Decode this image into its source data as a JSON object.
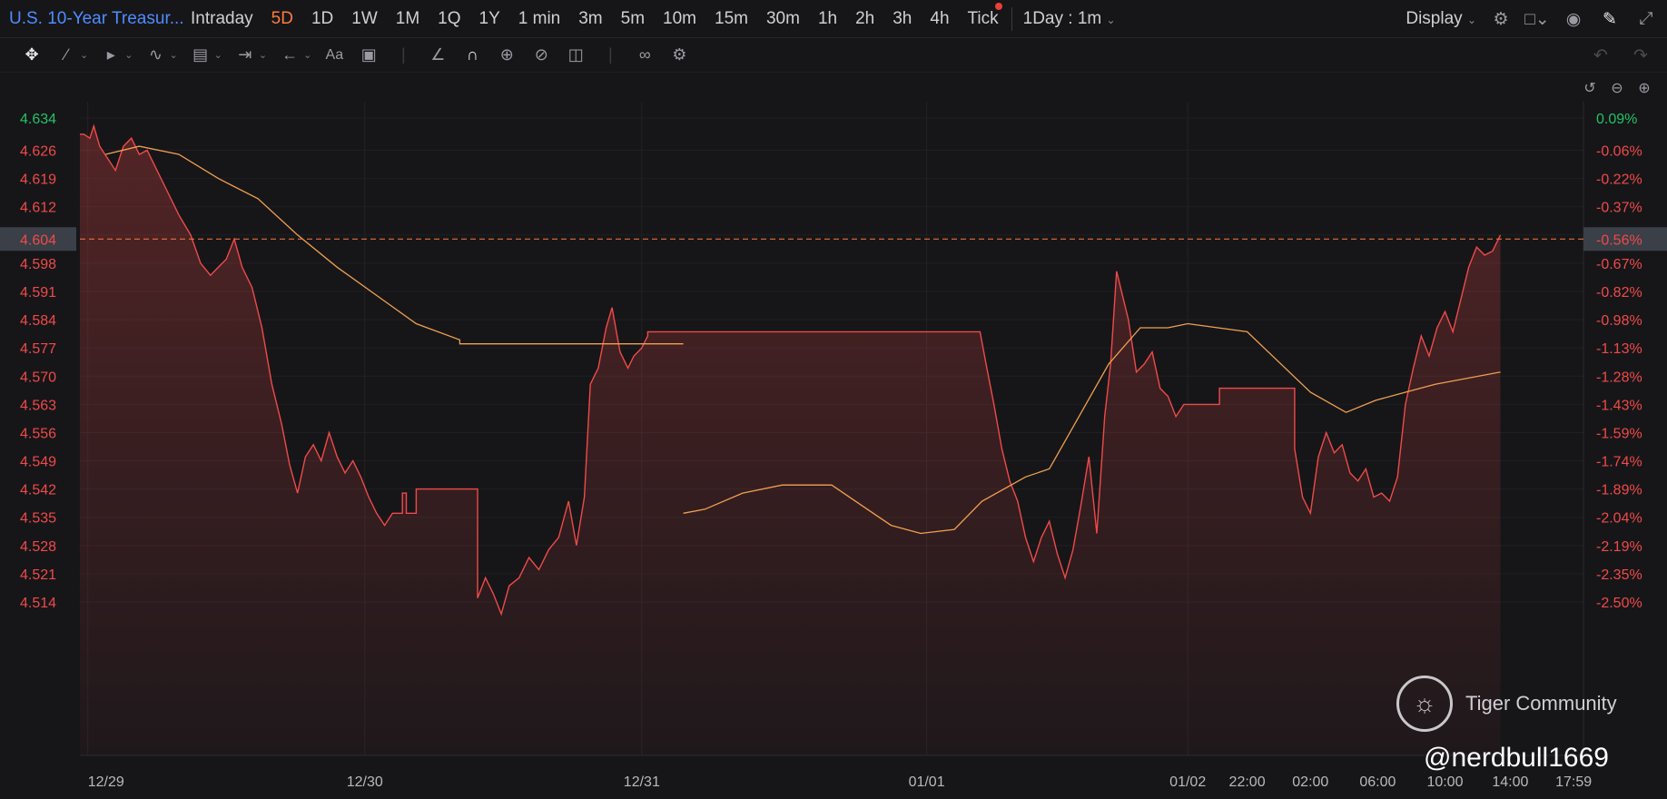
{
  "header": {
    "symbol": "U.S. 10-Year Treasur...",
    "periods": [
      "Intraday",
      "5D",
      "1D",
      "1W",
      "1M",
      "1Q",
      "1Y",
      "1 min",
      "3m",
      "5m",
      "10m",
      "15m",
      "30m",
      "1h",
      "2h",
      "3h",
      "4h",
      "Tick"
    ],
    "active_period": "5D",
    "interval": "1Day : 1m",
    "display_label": "Display"
  },
  "toolbar": {
    "icons": [
      "move-icon",
      "line-tool-icon",
      "channel-tool-icon",
      "pattern-tool-icon",
      "fib-tool-icon",
      "measure-tool-icon",
      "arrow-tool-icon",
      "text-tool-icon",
      "note-tool-icon",
      "ruler-tool-icon",
      "magnet-icon",
      "lock-drawings-icon",
      "hide-drawings-icon",
      "delete-icon",
      "link-icon",
      "settings-icon"
    ]
  },
  "watermark": {
    "brand": "Tiger Community",
    "handle": "@nerdbull1669"
  },
  "colors": {
    "background": "#161619",
    "price_line": "#f04a48",
    "avg_line": "#f0a050",
    "up": "#24c264",
    "down": "#f04a48",
    "accent": "#ff7a3d",
    "symbol": "#4f8cff"
  },
  "chart_data": {
    "type": "line",
    "x_labels": [
      "12/29",
      "12/30",
      "12/31",
      "01/01",
      "01/02",
      "22:00",
      "02:00",
      "06:00",
      "10:00",
      "14:00",
      "17:59"
    ],
    "y_ticks": [
      4.634,
      4.626,
      4.619,
      4.612,
      4.605,
      4.598,
      4.591,
      4.584,
      4.577,
      4.57,
      4.563,
      4.556,
      4.549,
      4.542,
      4.535,
      4.528,
      4.521,
      4.514
    ],
    "pct_ticks": [
      "0.09%",
      "-0.06%",
      "-0.22%",
      "-0.37%",
      "-0.52%",
      "-0.67%",
      "-0.82%",
      "-0.98%",
      "-1.13%",
      "-1.28%",
      "-1.43%",
      "-1.59%",
      "-1.74%",
      "-1.89%",
      "-2.04%",
      "-2.19%",
      "-2.35%",
      "-2.50%"
    ],
    "current_price": 4.604,
    "current_pct": "-0.56%",
    "ylim": [
      4.507,
      4.637
    ],
    "series": [
      {
        "key": "price",
        "points": [
          [
            0.0,
            4.63
          ],
          [
            0.2,
            4.63
          ],
          [
            0.5,
            4.629
          ],
          [
            0.7,
            4.632
          ],
          [
            1.0,
            4.627
          ],
          [
            1.4,
            4.624
          ],
          [
            1.8,
            4.621
          ],
          [
            2.2,
            4.627
          ],
          [
            2.6,
            4.629
          ],
          [
            3.0,
            4.625
          ],
          [
            3.4,
            4.626
          ],
          [
            3.8,
            4.622
          ],
          [
            4.4,
            4.616
          ],
          [
            5.0,
            4.61
          ],
          [
            5.6,
            4.605
          ],
          [
            6.1,
            4.598
          ],
          [
            6.6,
            4.595
          ],
          [
            7.0,
            4.597
          ],
          [
            7.4,
            4.599
          ],
          [
            7.8,
            4.604
          ],
          [
            8.2,
            4.597
          ],
          [
            8.7,
            4.592
          ],
          [
            9.2,
            4.582
          ],
          [
            9.7,
            4.568
          ],
          [
            10.2,
            4.558
          ],
          [
            10.6,
            4.548
          ],
          [
            11.0,
            4.541
          ],
          [
            11.4,
            4.55
          ],
          [
            11.8,
            4.553
          ],
          [
            12.2,
            4.549
          ],
          [
            12.6,
            4.556
          ],
          [
            13.0,
            4.55
          ],
          [
            13.4,
            4.546
          ],
          [
            13.8,
            4.549
          ],
          [
            14.2,
            4.545
          ],
          [
            14.6,
            4.54
          ],
          [
            15.0,
            4.536
          ],
          [
            15.4,
            4.533
          ],
          [
            15.8,
            4.536
          ],
          [
            16.3,
            4.536
          ],
          [
            16.3,
            4.541
          ],
          [
            16.5,
            4.541
          ],
          [
            16.5,
            4.536
          ],
          [
            17.0,
            4.536
          ],
          [
            17.0,
            4.542
          ],
          [
            20.1,
            4.542
          ],
          [
            20.1,
            4.515
          ],
          [
            20.5,
            4.52
          ],
          [
            20.9,
            4.516
          ],
          [
            21.3,
            4.511
          ],
          [
            21.7,
            4.518
          ],
          [
            22.2,
            4.52
          ],
          [
            22.7,
            4.525
          ],
          [
            23.2,
            4.522
          ],
          [
            23.7,
            4.527
          ],
          [
            24.2,
            4.53
          ],
          [
            24.7,
            4.539
          ],
          [
            25.1,
            4.528
          ],
          [
            25.5,
            4.54
          ],
          [
            25.8,
            4.568
          ],
          [
            26.2,
            4.572
          ],
          [
            26.6,
            4.582
          ],
          [
            26.9,
            4.587
          ],
          [
            27.3,
            4.576
          ],
          [
            27.7,
            4.572
          ],
          [
            28.0,
            4.575
          ],
          [
            28.4,
            4.577
          ],
          [
            28.7,
            4.58
          ],
          [
            28.7,
            4.581
          ],
          [
            45.5,
            4.581
          ],
          [
            45.8,
            4.573
          ],
          [
            46.2,
            4.563
          ],
          [
            46.6,
            4.552
          ],
          [
            47.0,
            4.544
          ],
          [
            47.4,
            4.539
          ],
          [
            47.8,
            4.53
          ],
          [
            48.2,
            4.524
          ],
          [
            48.6,
            4.53
          ],
          [
            49.0,
            4.534
          ],
          [
            49.4,
            4.526
          ],
          [
            49.8,
            4.52
          ],
          [
            50.2,
            4.527
          ],
          [
            50.6,
            4.538
          ],
          [
            51.0,
            4.55
          ],
          [
            51.4,
            4.531
          ],
          [
            51.8,
            4.56
          ],
          [
            52.1,
            4.573
          ],
          [
            52.4,
            4.596
          ],
          [
            52.7,
            4.59
          ],
          [
            53.0,
            4.584
          ],
          [
            53.4,
            4.571
          ],
          [
            53.8,
            4.573
          ],
          [
            54.2,
            4.576
          ],
          [
            54.6,
            4.567
          ],
          [
            55.0,
            4.565
          ],
          [
            55.4,
            4.56
          ],
          [
            55.8,
            4.563
          ],
          [
            55.8,
            4.563
          ],
          [
            57.6,
            4.563
          ],
          [
            57.6,
            4.567
          ],
          [
            61.4,
            4.567
          ],
          [
            61.4,
            4.552
          ],
          [
            61.8,
            4.54
          ],
          [
            62.2,
            4.536
          ],
          [
            62.6,
            4.55
          ],
          [
            63.0,
            4.556
          ],
          [
            63.4,
            4.551
          ],
          [
            63.8,
            4.553
          ],
          [
            64.2,
            4.546
          ],
          [
            64.6,
            4.544
          ],
          [
            65.0,
            4.547
          ],
          [
            65.4,
            4.54
          ],
          [
            65.8,
            4.541
          ],
          [
            66.2,
            4.539
          ],
          [
            66.6,
            4.545
          ],
          [
            67.0,
            4.563
          ],
          [
            67.4,
            4.572
          ],
          [
            67.8,
            4.58
          ],
          [
            68.2,
            4.575
          ],
          [
            68.6,
            4.582
          ],
          [
            69.0,
            4.586
          ],
          [
            69.4,
            4.581
          ],
          [
            69.8,
            4.589
          ],
          [
            70.2,
            4.597
          ],
          [
            70.6,
            4.602
          ],
          [
            71.0,
            4.6
          ],
          [
            71.4,
            4.601
          ],
          [
            71.8,
            4.605
          ]
        ]
      },
      {
        "key": "average",
        "points": [
          [
            1.3,
            4.625
          ],
          [
            3.0,
            4.627
          ],
          [
            5.0,
            4.625
          ],
          [
            7.0,
            4.619
          ],
          [
            9.0,
            4.614
          ],
          [
            11.0,
            4.605
          ],
          [
            13.0,
            4.597
          ],
          [
            15.0,
            4.59
          ],
          [
            17.0,
            4.583
          ],
          [
            19.2,
            4.579
          ],
          [
            19.2,
            4.578
          ],
          [
            30.5,
            4.578
          ],
          [
            30.5,
            4.536
          ],
          [
            31.6,
            4.537
          ],
          [
            33.5,
            4.541
          ],
          [
            35.5,
            4.543
          ],
          [
            38.0,
            4.543
          ],
          [
            39.5,
            4.538
          ],
          [
            41.0,
            4.533
          ],
          [
            42.5,
            4.531
          ],
          [
            44.2,
            4.532
          ],
          [
            45.6,
            4.539
          ],
          [
            47.8,
            4.545
          ],
          [
            49.0,
            4.547
          ],
          [
            50.5,
            4.56
          ],
          [
            52.0,
            4.573
          ],
          [
            53.6,
            4.582
          ],
          [
            55.0,
            4.582
          ],
          [
            56.0,
            4.583
          ],
          [
            59.0,
            4.581
          ],
          [
            62.2,
            4.566
          ],
          [
            64.0,
            4.561
          ],
          [
            65.5,
            4.564
          ],
          [
            67.0,
            4.566
          ],
          [
            68.5,
            4.568
          ],
          [
            71.8,
            4.571
          ]
        ]
      }
    ],
    "x_label_positions": [
      0.4,
      14.4,
      28.4,
      42.8,
      56.0,
      59.0,
      62.2,
      65.6,
      69.0,
      72.3,
      75.5
    ]
  }
}
